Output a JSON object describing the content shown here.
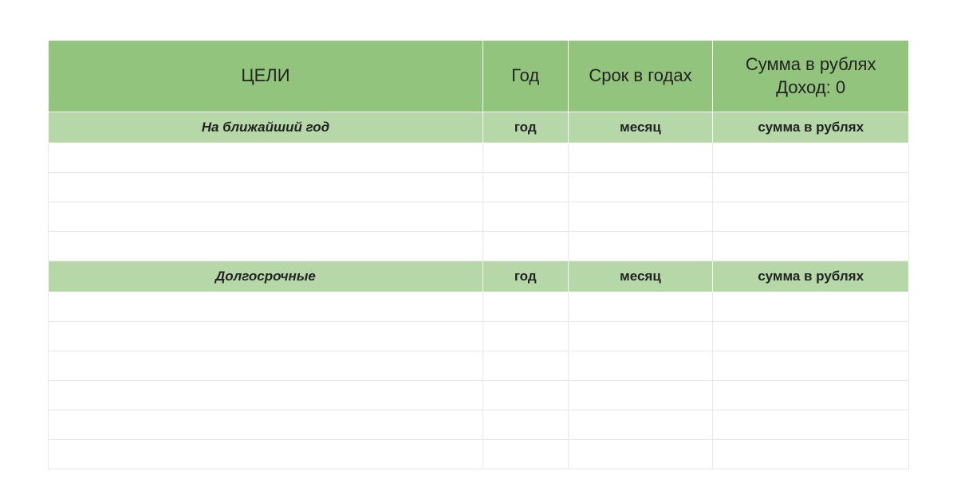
{
  "header": {
    "goals": "ЦЕЛИ",
    "year": "Год",
    "term": "Срок в годах",
    "sum_line1": "Сумма в рублях",
    "sum_line2": "Доход: 0"
  },
  "sections": [
    {
      "title": "На ближайший год",
      "year": "год",
      "month": "месяц",
      "sum": "сумма в рублях",
      "empty_rows": 4
    },
    {
      "title": "Долгосрочные",
      "year": "год",
      "month": "месяц",
      "sum": "сумма в рублях",
      "empty_rows": 6
    }
  ]
}
